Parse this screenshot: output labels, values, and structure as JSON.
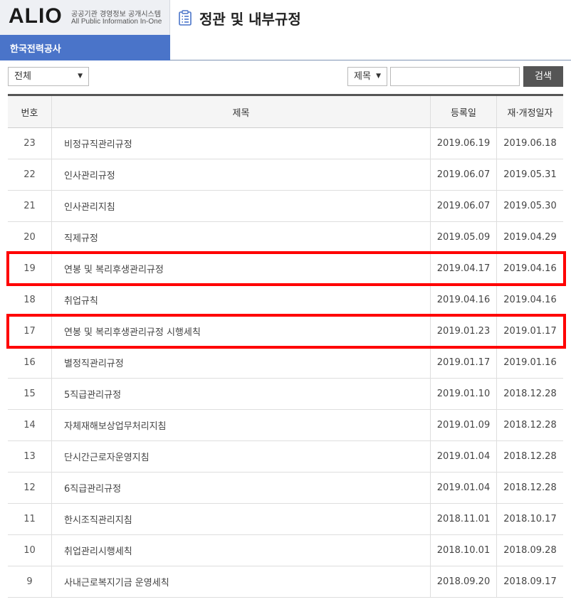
{
  "header": {
    "logo": "ALIO",
    "logo_sub_ko": "공공기관 경영정보 공개시스템",
    "logo_sub_en": "All Public Information In-One",
    "org_name": "한국전력공사",
    "page_title": "정관 및 내부규정",
    "title_icon": "list-document-icon"
  },
  "toolbar": {
    "category_value": "전체",
    "field_value": "제목",
    "search_value": "",
    "search_button": "검색"
  },
  "table": {
    "headers": [
      "번호",
      "제목",
      "등록일",
      "재·개정일자"
    ],
    "rows": [
      {
        "no": "23",
        "title": "비정규직관리규정",
        "reg": "2019.06.19",
        "rev": "2019.06.18"
      },
      {
        "no": "22",
        "title": "인사관리규정",
        "reg": "2019.06.07",
        "rev": "2019.05.31"
      },
      {
        "no": "21",
        "title": "인사관리지침",
        "reg": "2019.06.07",
        "rev": "2019.05.30"
      },
      {
        "no": "20",
        "title": "직제규정",
        "reg": "2019.05.09",
        "rev": "2019.04.29"
      },
      {
        "no": "19",
        "title": "연봉 및 복리후생관리규정",
        "reg": "2019.04.17",
        "rev": "2019.04.16"
      },
      {
        "no": "18",
        "title": "취업규칙",
        "reg": "2019.04.16",
        "rev": "2019.04.16"
      },
      {
        "no": "17",
        "title": "연봉 및 복리후생관리규정 시행세칙",
        "reg": "2019.01.23",
        "rev": "2019.01.17"
      },
      {
        "no": "16",
        "title": "별정직관리규정",
        "reg": "2019.01.17",
        "rev": "2019.01.16"
      },
      {
        "no": "15",
        "title": "5직급관리규정",
        "reg": "2019.01.10",
        "rev": "2018.12.28"
      },
      {
        "no": "14",
        "title": "자체재해보상업무처리지침",
        "reg": "2019.01.09",
        "rev": "2018.12.28"
      },
      {
        "no": "13",
        "title": "단시간근로자운영지침",
        "reg": "2019.01.04",
        "rev": "2018.12.28"
      },
      {
        "no": "12",
        "title": "6직급관리규정",
        "reg": "2019.01.04",
        "rev": "2018.12.28"
      },
      {
        "no": "11",
        "title": "한시조직관리지침",
        "reg": "2018.11.01",
        "rev": "2018.10.17"
      },
      {
        "no": "10",
        "title": "취업관리시행세칙",
        "reg": "2018.10.01",
        "rev": "2018.09.28"
      },
      {
        "no": "9",
        "title": "사내근로복지기금 운영세칙",
        "reg": "2018.09.20",
        "rev": "2018.09.17"
      }
    ]
  },
  "colors": {
    "org_bar": "#4a74c9",
    "highlight": "#ff0000",
    "search_button": "#555555"
  }
}
